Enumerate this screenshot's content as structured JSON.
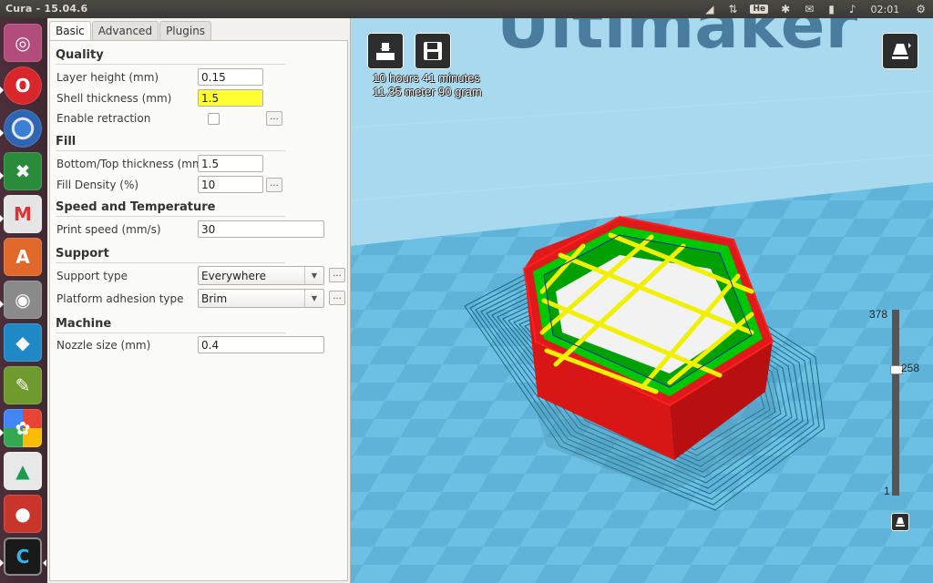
{
  "window": {
    "title": "Cura - 15.04.6"
  },
  "tray": {
    "keyboard": "He",
    "clock": "02:01"
  },
  "launcher": {
    "apps": [
      "ubuntu-icon",
      "opera-icon",
      "chromium-icon",
      "xsane-icon",
      "gmail-icon",
      "software-center-icon",
      "camera-icon",
      "kodi-icon",
      "paint-icon",
      "photos-icon",
      "google-drive-icon",
      "recorder-icon",
      "cura-icon"
    ]
  },
  "tabs": [
    "Basic",
    "Advanced",
    "Plugins"
  ],
  "sections": {
    "quality": "Quality",
    "fill": "Fill",
    "speed": "Speed and Temperature",
    "support": "Support",
    "machine": "Machine"
  },
  "fields": {
    "layer_height": {
      "label": "Layer height (mm)",
      "value": "0.15"
    },
    "shell_thickness": {
      "label": "Shell thickness (mm)",
      "value": "1.5"
    },
    "retraction": {
      "label": "Enable retraction",
      "checked": false
    },
    "bottom_top": {
      "label": "Bottom/Top thickness (mm)",
      "value": "1.5"
    },
    "fill_density": {
      "label": "Fill Density (%)",
      "value": "10"
    },
    "print_speed": {
      "label": "Print speed (mm/s)",
      "value": "30"
    },
    "support_type": {
      "label": "Support type",
      "value": "Everywhere"
    },
    "adhesion": {
      "label": "Platform adhesion type",
      "value": "Brim"
    },
    "nozzle": {
      "label": "Nozzle size (mm)",
      "value": "0.4"
    }
  },
  "ellipsis": "...",
  "viewport": {
    "print_time": "10 hours 41 minutes",
    "material": "11.35 meter 90 gram",
    "layer_max": "378",
    "layer_current": "258",
    "layer_min": "1",
    "layer_fraction": 0.682,
    "watermark": "Ultimaker"
  },
  "colors": {
    "bed": "#66bbdf",
    "shell": "#e01a1a",
    "inner_wall": "#00c800",
    "infill": "#f0f000",
    "skirt": "#1a6b80"
  }
}
